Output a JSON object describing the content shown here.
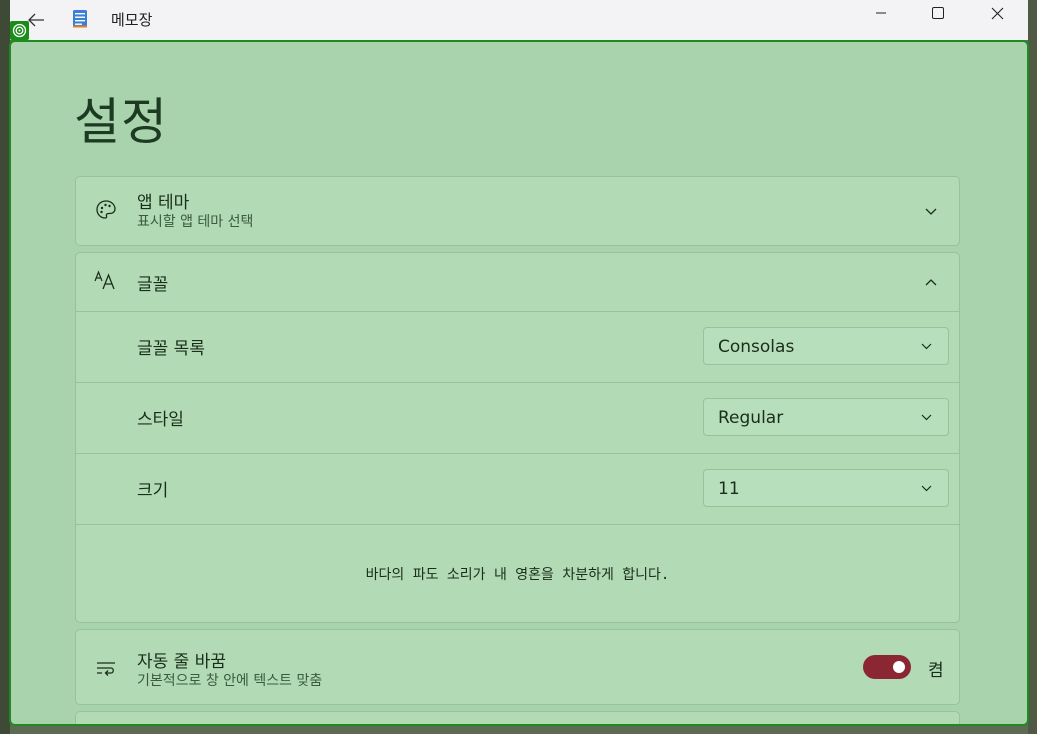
{
  "window": {
    "title": "메모장",
    "back_icon": "arrow-left-icon",
    "app_icon": "notepad-icon",
    "controls": [
      "minimize-icon",
      "maximize-icon",
      "close-icon"
    ]
  },
  "page": {
    "title": "설정"
  },
  "settings": {
    "app_theme": {
      "title": "앱 테마",
      "subtitle": "표시할 앱 테마 선택",
      "icon": "palette-icon"
    },
    "font": {
      "title": "글꼴",
      "icon": "font-icon",
      "expanded": true,
      "family": {
        "label": "글꼴 목록",
        "value": "Consolas"
      },
      "style": {
        "label": "스타일",
        "value": "Regular"
      },
      "size": {
        "label": "크기",
        "value": "11"
      },
      "preview_text": "바다의 파도 소리가 내 영혼을 차분하게 합니다."
    },
    "word_wrap": {
      "title": "자동 줄 바꿈",
      "subtitle": "기본적으로 창 안에 텍스트 맞춤",
      "icon": "word-wrap-icon",
      "toggle_on": true,
      "toggle_label": "켬",
      "toggle_color": "#8b2633"
    }
  }
}
